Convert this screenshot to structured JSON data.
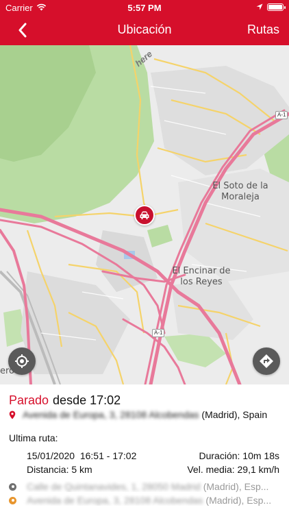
{
  "status_bar": {
    "carrier": "Carrier",
    "time": "5:57 PM",
    "battery_level": 1.0
  },
  "nav": {
    "back_icon": "chevron-left-icon",
    "title": "Ubicación",
    "right_action": "Rutas"
  },
  "map": {
    "provider_logo": "here",
    "places": [
      "El Soto de la\nMoraleja",
      "El Encinar de\nlos Reyes",
      "ero"
    ],
    "road_shields": [
      "A-1",
      "A-1"
    ],
    "colors": {
      "highway": "#e8799a",
      "major_road": "#f5d36a",
      "green": "#b9dca3",
      "marker": "#c8102e"
    }
  },
  "vehicle": {
    "status": "Parado",
    "since": "desde 17:02",
    "address_blurred": "Avenida de Europa, 3, 28108 Alcobendas",
    "address_suffix": "(Madrid), Spain"
  },
  "last_route": {
    "label": "Ultima ruta:",
    "date_time": "15/01/2020  16:51 - 17:02",
    "duration": "Duración: 10m 18s",
    "distance": "Distancia: 5 km",
    "avg_speed": "Vel. media: 29,1 km/h",
    "start_blurred": "Calle de Quintanavides, 1, 28050 Madrid",
    "start_suffix": "(Madrid), Esp...",
    "end_blurred": "Avenida de Europa, 3, 28108 Alcobendas",
    "end_suffix": "(Madrid), Esp...",
    "start_color": "#707070",
    "end_color": "#e8962e"
  }
}
